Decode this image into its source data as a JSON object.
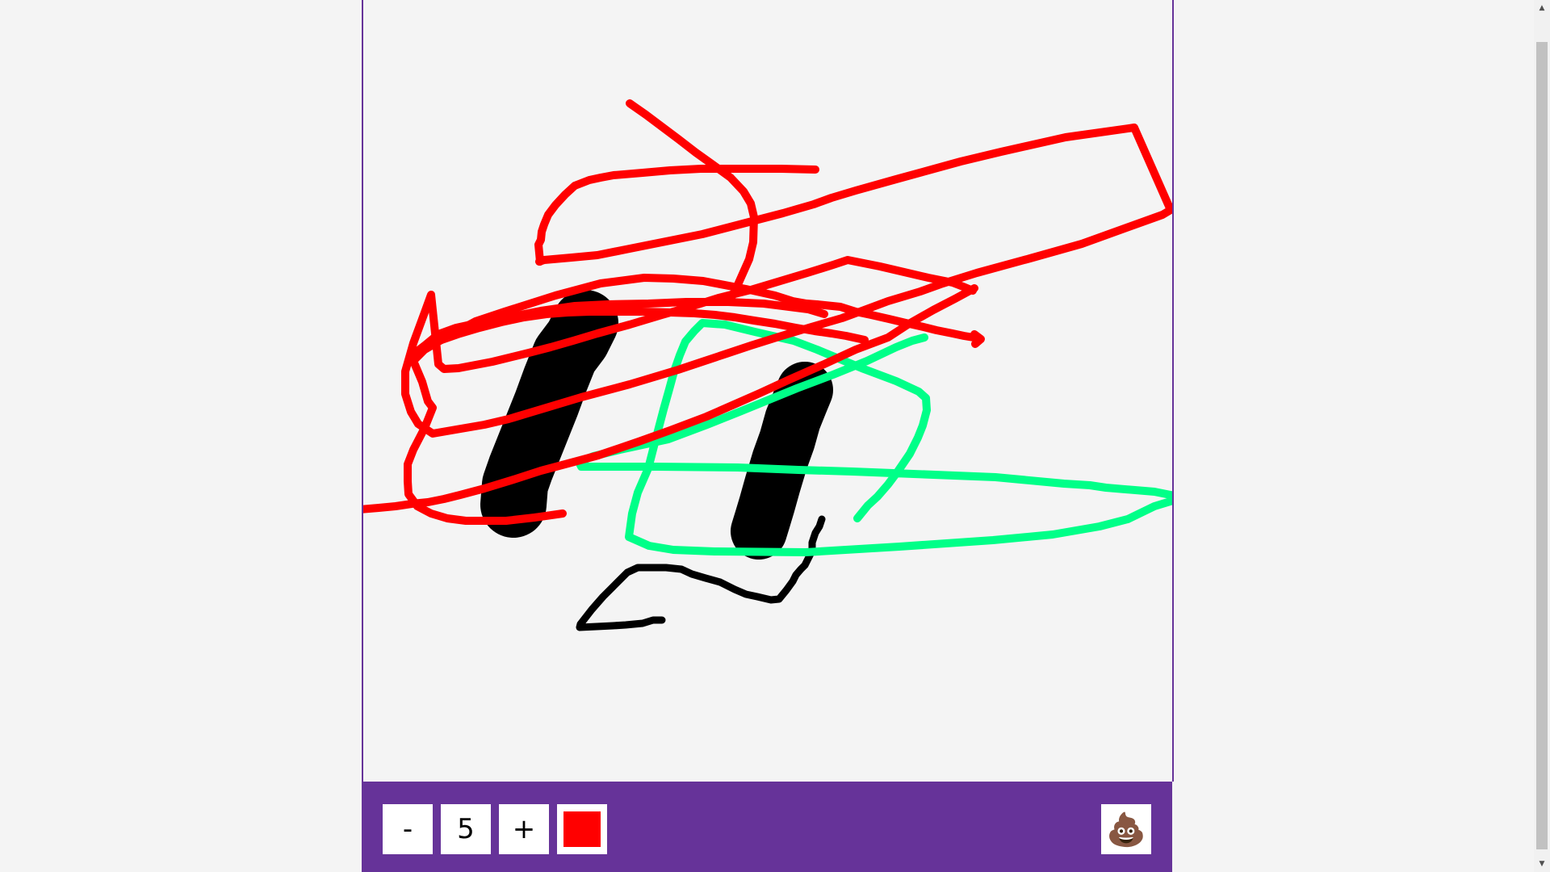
{
  "toolbar": {
    "minus_label": "-",
    "brush_size": "5",
    "plus_label": "+",
    "current_color": "#ff0000",
    "poop_label": "💩"
  },
  "colors": {
    "toolbar_bg": "#663399",
    "canvas_bg": "#f4f4f4"
  },
  "scrollbar": {
    "up_arrow": "▲",
    "down_arrow": "▼"
  }
}
